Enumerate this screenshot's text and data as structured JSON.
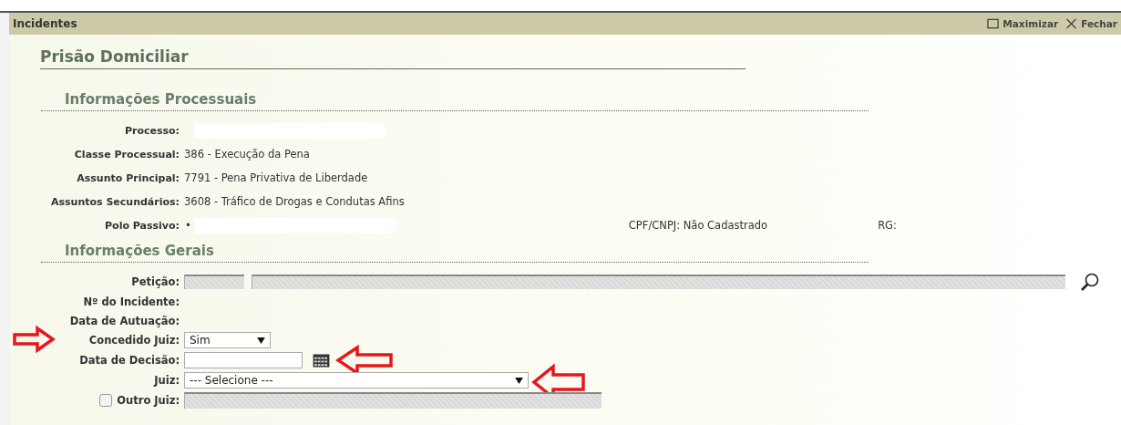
{
  "window": {
    "title": "Incidentes",
    "actions": [
      {
        "kind": "maximize",
        "label": "Maximizar"
      },
      {
        "kind": "close",
        "label": "Fechar"
      }
    ]
  },
  "page_title": "Prisão Domiciliar",
  "process_info": {
    "title": "Informações Processuais",
    "fields": [
      {
        "kind": "redacted",
        "label": "Processo:"
      },
      {
        "kind": "text",
        "label": "Classe Processual:",
        "value": "386 - Execução da Pena"
      },
      {
        "kind": "text",
        "label": "Assunto Principal:",
        "value": "7791 - Pena Privativa de Liberdade"
      },
      {
        "kind": "text",
        "label": "Assuntos Secundários:",
        "value": "3608 - Tráfico de Drogas e Condutas Afins"
      }
    ],
    "passive_party": {
      "label": "Polo Passivo:",
      "bullet": "•",
      "cpf": "CPF/CNPJ: Não Cadastrado",
      "rg": "RG:"
    }
  },
  "general_info": {
    "title": "Informações Gerais",
    "petition": {
      "label": "Petição:"
    },
    "incident_number": {
      "label": "Nº do Incidente:"
    },
    "filing_date": {
      "label": "Data de Autuação:"
    },
    "granted_by_judge": {
      "label": "Concedido Juiz:",
      "value": "Sim"
    },
    "decision_date": {
      "label": "Data de Decisão:"
    },
    "judge": {
      "label": "Juiz:",
      "value": "--- Selecione ---"
    },
    "other_judge": {
      "label": "Outro Juiz:",
      "checked": false
    }
  }
}
